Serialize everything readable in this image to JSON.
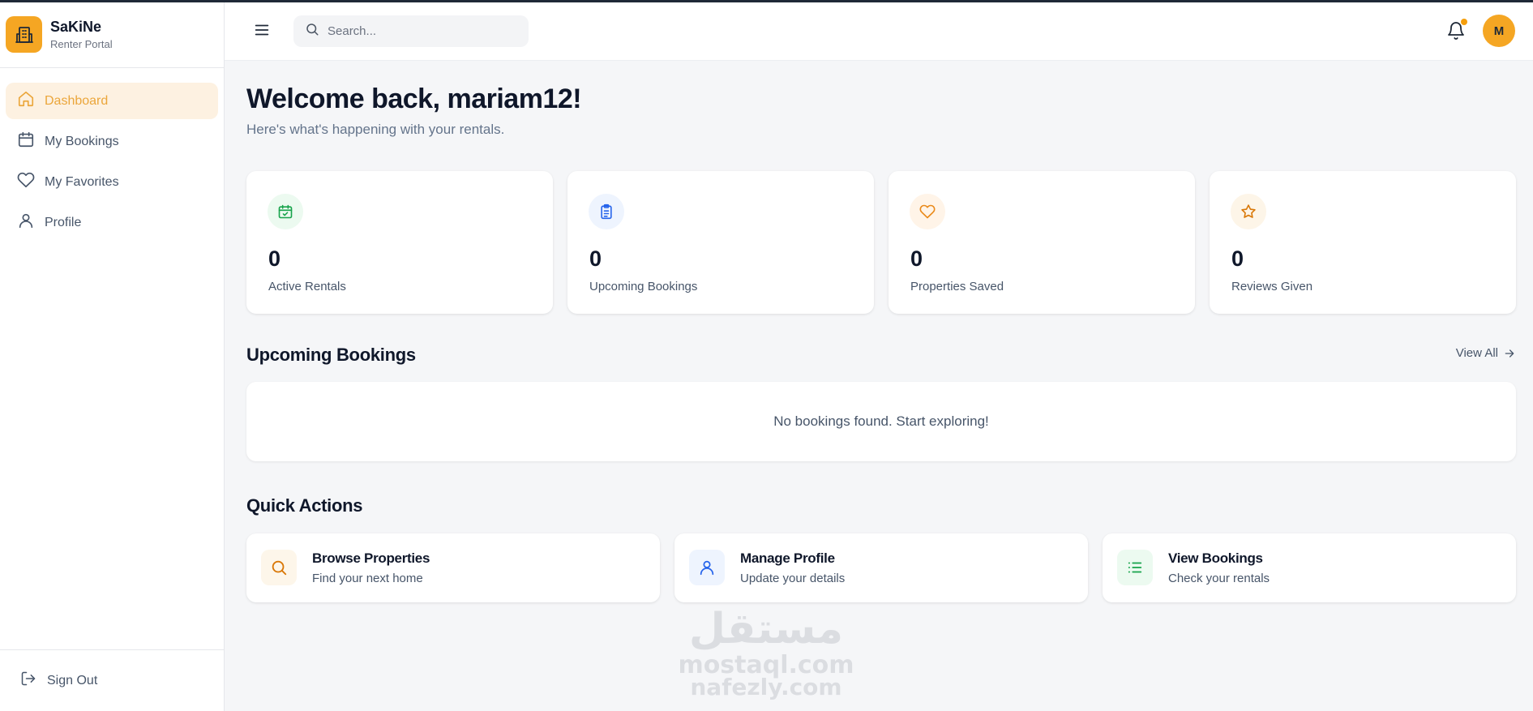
{
  "brand": {
    "name": "SaKiNe",
    "subtitle": "Renter Portal",
    "accent": "#f5a623"
  },
  "sidebar": {
    "items": [
      {
        "label": "Dashboard",
        "icon": "home-icon",
        "active": true
      },
      {
        "label": "My Bookings",
        "icon": "calendar-icon",
        "active": false
      },
      {
        "label": "My Favorites",
        "icon": "heart-icon",
        "active": false
      },
      {
        "label": "Profile",
        "icon": "user-icon",
        "active": false
      }
    ],
    "signout_label": "Sign Out"
  },
  "header": {
    "search_placeholder": "Search...",
    "avatar_initial": "M",
    "has_notification": true
  },
  "main": {
    "welcome": "Welcome back, mariam12!",
    "subtitle": "Here's what's happening with your rentals.",
    "stats": [
      {
        "value": "0",
        "label": "Active Rentals",
        "icon": "calendar-check-icon",
        "color": "#16a34a"
      },
      {
        "value": "0",
        "label": "Upcoming Bookings",
        "icon": "clipboard-list-icon",
        "color": "#2563eb"
      },
      {
        "value": "0",
        "label": "Properties Saved",
        "icon": "heart-icon",
        "color": "#ea8a1a"
      },
      {
        "value": "0",
        "label": "Reviews Given",
        "icon": "star-icon",
        "color": "#d97706"
      }
    ],
    "upcoming": {
      "title": "Upcoming Bookings",
      "view_all": "View All",
      "empty_message": "No bookings found. Start exploring!"
    },
    "quick_actions": {
      "title": "Quick Actions",
      "items": [
        {
          "title": "Browse Properties",
          "subtitle": "Find your next home",
          "icon": "search-icon",
          "color": "#d97706"
        },
        {
          "title": "Manage Profile",
          "subtitle": "Update your details",
          "icon": "user-icon",
          "color": "#2563eb"
        },
        {
          "title": "View Bookings",
          "subtitle": "Check your rentals",
          "icon": "list-icon",
          "color": "#16a34a"
        }
      ]
    }
  },
  "watermark": {
    "line1": "مستقل",
    "line2": "mostaql.com",
    "line3": "nafezly.com"
  }
}
